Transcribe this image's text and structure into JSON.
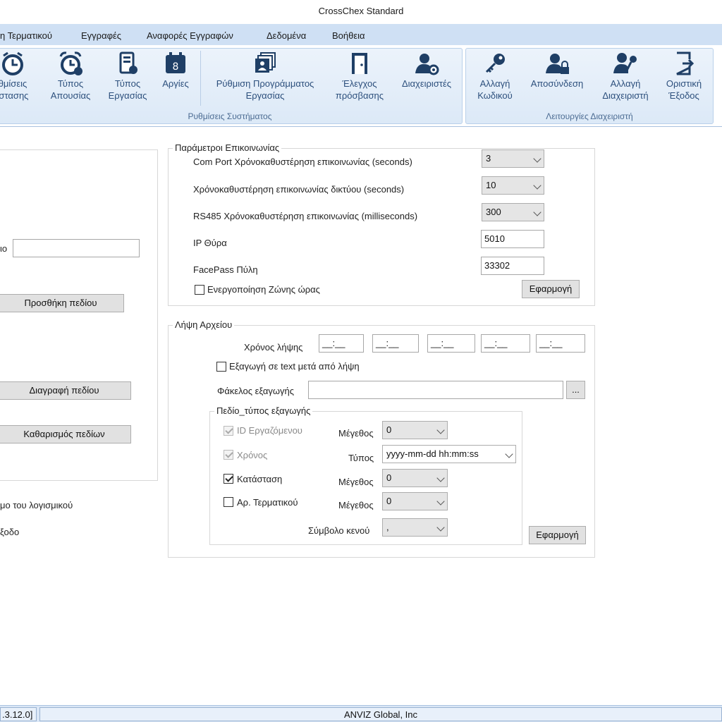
{
  "window": {
    "title": "CrossChex Standard"
  },
  "menu": [
    {
      "label": "η Τερματικού"
    },
    {
      "label": "Εγγραφές"
    },
    {
      "label": "Αναφορές Εγγραφών"
    },
    {
      "label": "Δεδομένα"
    },
    {
      "label": "Βοήθεια"
    }
  ],
  "ribbon": {
    "group1": {
      "caption": "Ρυθμίσεις Συστήματος",
      "buttons": [
        {
          "line1": "θμίσεις",
          "line2": "ιστασης",
          "icon": "clock-icon"
        },
        {
          "line1": "Τύπος",
          "line2": "Απουσίας",
          "icon": "alarm-clock-icon"
        },
        {
          "line1": "Τύπος",
          "line2": "Εργασίας",
          "icon": "work-type-icon"
        },
        {
          "line1": "Αργίες",
          "line2": "",
          "icon": "calendar-icon"
        },
        {
          "line1": "Ρύθμιση Προγράμματος",
          "line2": "Εργασίας",
          "icon": "schedule-icon"
        },
        {
          "line1": "Έλεγχος",
          "line2": "πρόσβασης",
          "icon": "door-icon"
        },
        {
          "line1": "Διαχειριστές",
          "line2": "",
          "icon": "user-gear-icon"
        }
      ]
    },
    "group2": {
      "caption": "Λειτουργίες Διαχειριστή",
      "buttons": [
        {
          "line1": "Αλλαγή",
          "line2": "Κωδικού",
          "icon": "key-icon"
        },
        {
          "line1": "Αποσύνδεση",
          "line2": "",
          "icon": "user-lock-icon"
        },
        {
          "line1": "Αλλαγή",
          "line2": "Διαχειριστή",
          "icon": "user-key-icon"
        },
        {
          "line1": "Οριστική",
          "line2": "Έξοδος",
          "icon": "exit-icon"
        }
      ]
    }
  },
  "left_panel": {
    "field_label_fragment": "ιο",
    "field_value": "",
    "add_field": "Προσθήκη πεδίου",
    "delete_field": "Διαγραφή πεδίου",
    "clear_fields": "Καθαρισμός πεδίων",
    "text1": "μο του λογισμικού",
    "text2": "ξοδο"
  },
  "comm": {
    "legend": "Παράμετροι Επικοινωνίας",
    "comport_label": "Com Port Χρόνοκαθυστέρηση επικοινωνίας (seconds)",
    "comport_value": "3",
    "net_label": "Χρόνοκαθυστέρηση επικοινωνίας δικτύου (seconds)",
    "net_value": "10",
    "rs485_label": "RS485 Χρόνοκαθυστέρηση επικοινωνίας (milliseconds)",
    "rs485_value": "300",
    "ip_label": "IP Θύρα",
    "ip_value": "5010",
    "facepass_label": "FacePass Πύλη",
    "facepass_value": "33302",
    "timezone_label": "Ενεργοποίηση Ζώνης ώρας",
    "timezone_checked": false,
    "apply": "Εφαρμογή"
  },
  "download": {
    "legend": "Λήψη Αρχείου",
    "time_label": "Χρόνος λήψης",
    "times": [
      "__:__",
      "__:__",
      "__:__",
      "__:__",
      "__:__"
    ],
    "export_text_label": "Εξαγωγή σε text μετά από λήψη",
    "export_text_checked": false,
    "folder_label": "Φάκελος εξαγωγής",
    "folder_value": "",
    "browse": "...",
    "export_fields": {
      "legend": "Πεδίο_τύπος εξαγωγής",
      "employee_id": {
        "label": "ID Εργαζόμενου",
        "size_label": "Μέγεθος",
        "size_value": "0"
      },
      "time": {
        "label": "Χρόνος",
        "type_label": "Τύπος",
        "type_value": "yyyy-mm-dd hh:mm:ss"
      },
      "status": {
        "label": "Κατάσταση",
        "size_label": "Μέγεθος",
        "size_value": "0"
      },
      "terminal_no": {
        "label": "Αρ. Τερματικού",
        "size_label": "Μέγεθος",
        "size_value": "0"
      },
      "blank_label": "Σύμβολο κενού",
      "blank_value": ","
    },
    "apply": "Εφαρμογή"
  },
  "status": {
    "version": ".3.12.0]",
    "company": "ANVIZ Global, Inc"
  }
}
